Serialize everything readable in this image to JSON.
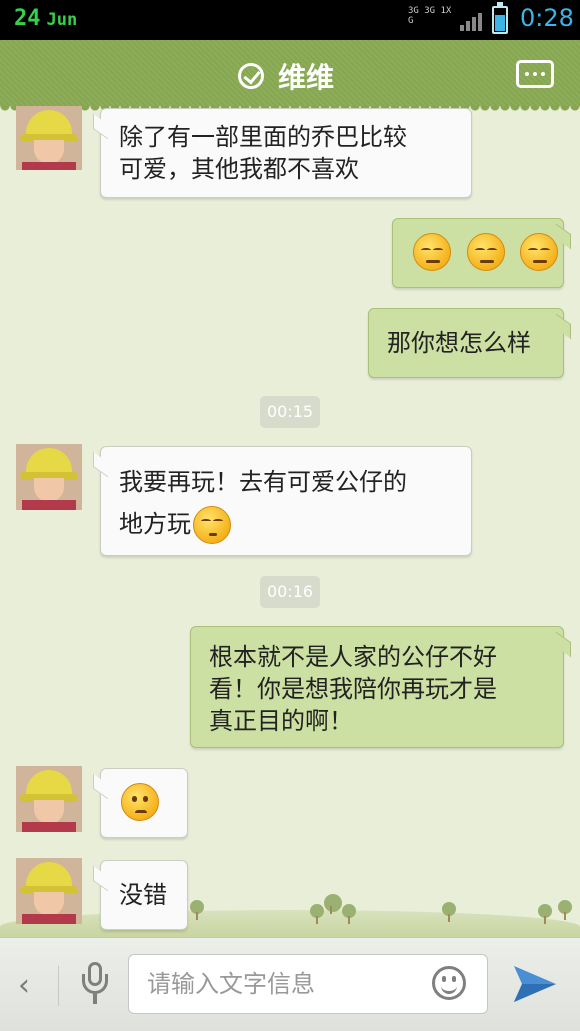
{
  "status_bar": {
    "date_day": "24",
    "date_month": "Jun",
    "network_label": "3G 3G 1X G",
    "time": "0:28"
  },
  "header": {
    "title": "维维",
    "verified_icon": "check-circle-icon",
    "menu_icon": "more-icon"
  },
  "messages": [
    {
      "side": "left",
      "text_line1": "除了有一部里面的乔巴比较",
      "text_line2": "可爱，其他我都不喜欢"
    },
    {
      "side": "right",
      "emoji": "sweat-emoji",
      "count": 3
    },
    {
      "side": "right",
      "text": "那你想怎么样"
    },
    {
      "timestamp": "00:15"
    },
    {
      "side": "left",
      "text_line1": "我要再玩！去有可爱公仔的",
      "text_line2": "地方玩",
      "emoji": "shy-emoji"
    },
    {
      "timestamp": "00:16"
    },
    {
      "side": "right",
      "text_line1": "根本就不是人家的公仔不好",
      "text_line2": "看！你是想我陪你再玩才是",
      "text_line3": "真正目的啊！"
    },
    {
      "side": "left",
      "emoji": "confused-emoji"
    },
    {
      "side": "left",
      "text": "没错"
    }
  ],
  "input_bar": {
    "back_icon": "chevron-left-icon",
    "mic_icon": "microphone-icon",
    "placeholder": "请输入文字信息",
    "emoji_icon": "smiley-icon",
    "send_icon": "send-icon"
  },
  "colors": {
    "header": "#88a854",
    "chat_bg": "#e9eed9",
    "left_bubble": "#fafafa",
    "right_bubble": "#cde0a3",
    "time_accent": "#3cb4e5"
  }
}
